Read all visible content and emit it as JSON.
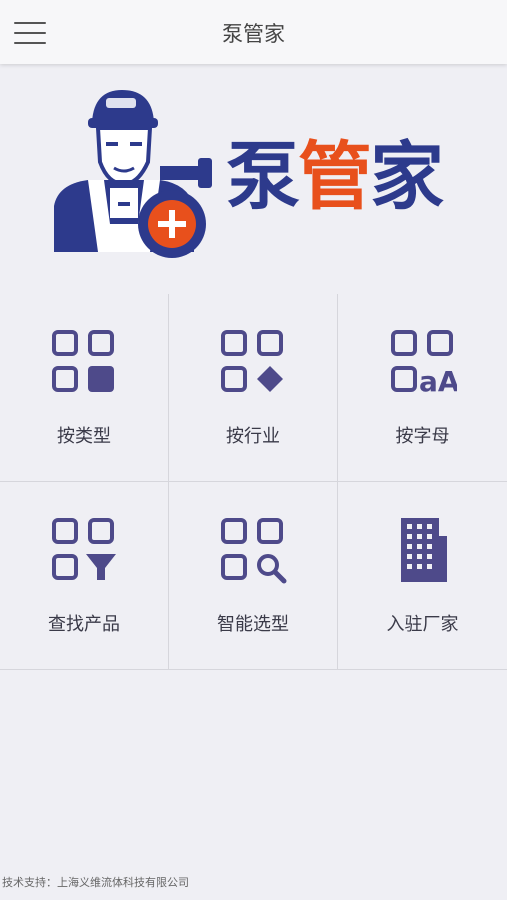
{
  "header": {
    "title": "泵管家",
    "menu_icon": "hamburger-menu-icon"
  },
  "logo": {
    "text": "泵管家",
    "colors": {
      "blue": "#2d3a8c",
      "orange": "#e8501c"
    }
  },
  "grid": {
    "items": [
      {
        "label": "按类型",
        "icon": "grid-square-icon"
      },
      {
        "label": "按行业",
        "icon": "grid-diamond-icon"
      },
      {
        "label": "按字母",
        "icon": "grid-letters-icon"
      },
      {
        "label": "查找产品",
        "icon": "grid-filter-icon"
      },
      {
        "label": "智能选型",
        "icon": "grid-search-icon"
      },
      {
        "label": "入驻厂家",
        "icon": "building-icon"
      }
    ],
    "icon_color": "#4e4a8a"
  },
  "footer": {
    "text": "技术支持：上海义维流体科技有限公司"
  }
}
